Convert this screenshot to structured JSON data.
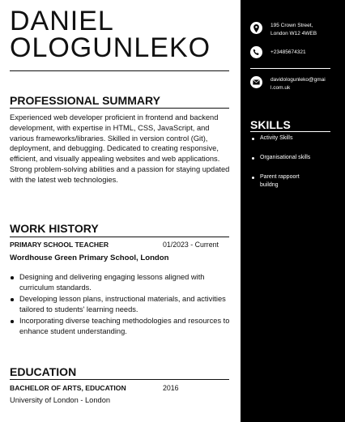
{
  "name": {
    "line1": "DANIEL",
    "line2": "OLOGUNLEKO"
  },
  "summary": {
    "heading": "PROFESSIONAL SUMMARY",
    "text": "Experienced web developer proficient in frontend and backend development, with expertise in HTML, CSS, JavaScript, and various frameworks/libraries. Skilled in version control (Git), deployment, and debugging. Dedicated to creating responsive, efficient, and visually appealing websites and web applications. Strong problem-solving abilities and a passion for staying updated with the latest web technologies."
  },
  "work": {
    "heading": "WORK HISTORY",
    "title": "PRIMARY SCHOOL TEACHER",
    "dates": "01/2023 - Current",
    "org": "Wordhouse Green Primary School, London",
    "bullets": [
      "Designing and delivering engaging lessons aligned with curriculum standards.",
      "Developing lesson plans, instructional materials, and activities tailored to students' learning needs.",
      "Incorporating diverse teaching methodologies and resources to enhance student understanding."
    ]
  },
  "education": {
    "heading": "EDUCATION",
    "degree": "BACHELOR OF ARTS, EDUCATION",
    "year": "2016",
    "school": "University of London - London"
  },
  "contact": {
    "address_line1": "195 Crown Street,",
    "address_line2": "London W12 4WEB",
    "phone": "+23485674321",
    "email_line1": "davidologunleko@gmai",
    "email_line2": "l.com.uk"
  },
  "skills": {
    "heading": "SKILLS",
    "items": [
      "Activity Skills",
      "Organisational skills",
      "Parent rappoort",
      "buildng"
    ]
  },
  "colors": {
    "sidebar": "#000000",
    "text": "#111111"
  }
}
